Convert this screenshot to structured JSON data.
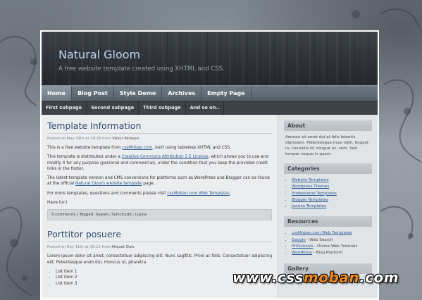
{
  "header": {
    "title": "Natural Gloom",
    "tagline": "A free website template created using XHTML and CSS."
  },
  "nav": {
    "items": [
      "Home",
      "Blog Post",
      "Style Demo",
      "Archives",
      "Empty Page"
    ]
  },
  "subnav": {
    "items": [
      "First subpage",
      "Second subpage",
      "Third subpage",
      "And so on.."
    ]
  },
  "post1": {
    "title": "Template Information",
    "meta_prefix": "Posted on May 19th at 18:28 from",
    "meta_author": "Viktor Persson",
    "p1_a": "This is a free website template from",
    "p1_link": "cssMoban.com",
    "p1_b": ", built using tableless XHTML and CSS.",
    "p2_a": "This template is distributed under a",
    "p2_link": "Creative Commons Attribution 2.5 License",
    "p2_b": ", which allows you to use and modify it for any purpose (personal and commercial), under the condition that you keep the provided credit links in the footer.",
    "p3_a": "The latest template version and CMS conversions for platforms such as WordPress and Blogger can be found at the official",
    "p3_link": "Natural Gloom website template",
    "p3_b": "page.",
    "p4_a": "For more templates, questions and comments please visit",
    "p4_link": "cssMoban.com Web Templates",
    "p4_b": ".",
    "p5": "Have fun!",
    "foot_comments": "5 comments",
    "foot_tags": "| Tagged: Sapien, Sollicitudin, Ligula"
  },
  "post2": {
    "title": "Porttitor posuere",
    "meta_prefix": "Posted on Dec 11th at 16:12 from",
    "meta_author": "Aliquet Quis",
    "p1": "Lorem ipsum dolor sit amet, consectetuer adipiscing elit. Nunc sagittis. Proin ac felis. Consectetuer adipiscing elit. Pellentesque enim dui, rhoncus ut, pharetra",
    "list": [
      "List item 1",
      "List item 2",
      "List item 3"
    ]
  },
  "sidebar": {
    "about_head": "About",
    "about_text": "Aenean sit amet dui at felis lobortis dignissim. Pellentesque risus nibh, feugiat in, convallis id, congue ac, sem. Sed tempor neque in quam.",
    "categories_head": "Categories",
    "categories": [
      "Website Templates",
      "Wordpress Themes",
      "Professional Templates",
      "Blogger Templates",
      "Joomla Templates"
    ],
    "resources_head": "Resources",
    "resources": [
      {
        "link": "cssMoban.com Web Templates",
        "suffix": ""
      },
      {
        "link": "Google",
        "suffix": " - Web Search"
      },
      {
        "link": "W3Schools",
        "suffix": " - Online Web Tutorials"
      },
      {
        "link": "WordPress",
        "suffix": " - Blog Platform"
      }
    ],
    "gallery_head": "Gallery"
  },
  "watermark": {
    "left": "www.css",
    "mid": "moban",
    "right": ".com"
  }
}
